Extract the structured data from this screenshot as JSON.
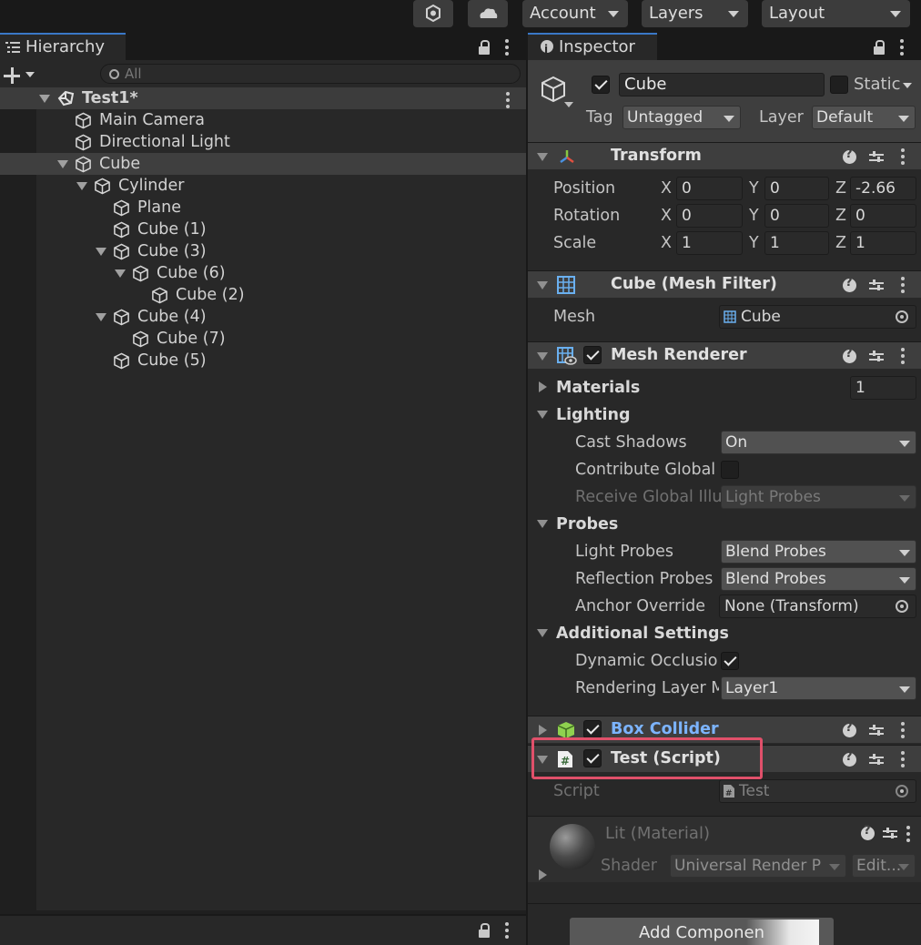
{
  "toolbar": {
    "account": "Account",
    "layers": "Layers",
    "layout": "Layout"
  },
  "hierarchy": {
    "tab": "Hierarchy",
    "search_placeholder": "All",
    "scene": "Test1*",
    "items": [
      {
        "label": "Main Camera",
        "depth": 1,
        "fold": "none"
      },
      {
        "label": "Directional Light",
        "depth": 1,
        "fold": "none"
      },
      {
        "label": "Cube",
        "depth": 1,
        "fold": "open",
        "selected": true
      },
      {
        "label": "Cylinder",
        "depth": 2,
        "fold": "open"
      },
      {
        "label": "Plane",
        "depth": 3,
        "fold": "none"
      },
      {
        "label": "Cube (1)",
        "depth": 3,
        "fold": "none"
      },
      {
        "label": "Cube (3)",
        "depth": 3,
        "fold": "open"
      },
      {
        "label": "Cube (6)",
        "depth": 4,
        "fold": "open"
      },
      {
        "label": "Cube (2)",
        "depth": 5,
        "fold": "none"
      },
      {
        "label": "Cube (4)",
        "depth": 3,
        "fold": "open"
      },
      {
        "label": "Cube (7)",
        "depth": 4,
        "fold": "none"
      },
      {
        "label": "Cube (5)",
        "depth": 3,
        "fold": "none"
      }
    ]
  },
  "inspector": {
    "tab": "Inspector",
    "object_name": "Cube",
    "static_label": "Static",
    "tag_label": "Tag",
    "tag_value": "Untagged",
    "layer_label": "Layer",
    "layer_value": "Default",
    "transform": {
      "title": "Transform",
      "position_label": "Position",
      "rotation_label": "Rotation",
      "scale_label": "Scale",
      "axis_x": "X",
      "axis_y": "Y",
      "axis_z": "Z",
      "position": {
        "x": "0",
        "y": "0",
        "z": "-2.66"
      },
      "rotation": {
        "x": "0",
        "y": "0",
        "z": "0"
      },
      "scale": {
        "x": "1",
        "y": "1",
        "z": "1"
      }
    },
    "mesh_filter": {
      "title": "Cube (Mesh Filter)",
      "mesh_label": "Mesh",
      "mesh_value": "Cube"
    },
    "mesh_renderer": {
      "title": "Mesh Renderer",
      "materials_label": "Materials",
      "materials_count": "1",
      "lighting_label": "Lighting",
      "cast_shadows_label": "Cast Shadows",
      "cast_shadows_value": "On",
      "contribute_gi_label": "Contribute Global",
      "receive_gi_label": "Receive Global Illu",
      "receive_gi_value": "Light Probes",
      "probes_label": "Probes",
      "light_probes_label": "Light Probes",
      "light_probes_value": "Blend Probes",
      "reflection_probes_label": "Reflection Probes",
      "reflection_probes_value": "Blend Probes",
      "anchor_override_label": "Anchor Override",
      "anchor_override_value": "None (Transform)",
      "additional_label": "Additional Settings",
      "dynamic_occlusion_label": "Dynamic Occlusio",
      "rendering_layer_label": "Rendering Layer M",
      "rendering_layer_value": "Layer1"
    },
    "box_collider": {
      "title": "Box Collider"
    },
    "test_script": {
      "title": "Test (Script)",
      "script_label": "Script",
      "script_value": "Test"
    },
    "material": {
      "title": "Lit (Material)",
      "shader_label": "Shader",
      "shader_value": "Universal Render P",
      "edit_label": "Edit..."
    },
    "add_component": "Add Componen"
  },
  "colors": {
    "accent_tab": "#3a78c7",
    "highlight": "#e0506a",
    "box_collider_title": "#7cb4ff"
  }
}
